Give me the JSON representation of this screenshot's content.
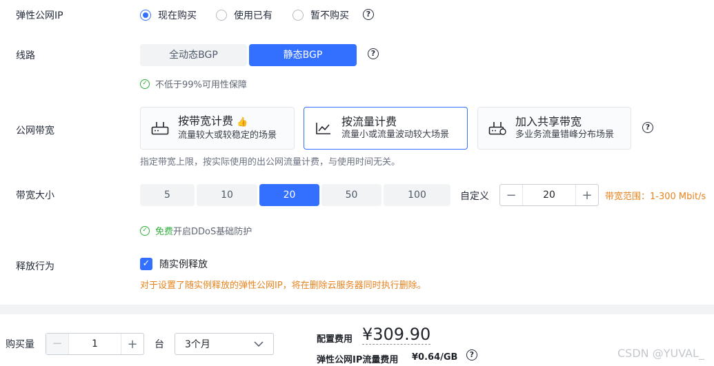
{
  "eip": {
    "label": "弹性公网IP",
    "options": [
      "现在购买",
      "使用已有",
      "暂不购买"
    ]
  },
  "line": {
    "label": "线路",
    "options": [
      "全动态BGP",
      "静态BGP"
    ],
    "note": "不低于99%可用性保障"
  },
  "bandwidth_type": {
    "label": "公网带宽",
    "cards": [
      {
        "title": "按带宽计费",
        "desc": "流量较大或较稳定的场景"
      },
      {
        "title": "按流量计费",
        "desc": "流量小或流量波动较大场景"
      },
      {
        "title": "加入共享带宽",
        "desc": "多业务流量错峰分布场景"
      }
    ],
    "note": "指定带宽上限，按实际使用的出公网流量计费，与使用时间无关。"
  },
  "bandwidth_size": {
    "label": "带宽大小",
    "options": [
      "5",
      "10",
      "20",
      "50",
      "100"
    ],
    "custom_label": "自定义",
    "minus": "−",
    "plus": "+",
    "custom_value": "20",
    "range": "带宽范围：1-300 Mbit/s",
    "ddos_free": "免费",
    "ddos_text": "开启DDoS基础防护"
  },
  "release": {
    "label": "释放行为",
    "checkbox_label": "随实例释放",
    "warning": "对于设置了随实例释放的弹性公网IP，将在删除云服务器同时执行删除。"
  },
  "footer": {
    "qty_label": "购买量",
    "qty_value": "1",
    "minus": "−",
    "plus": "+",
    "unit": "台",
    "duration": "3个月",
    "config_fee_label": "配置费用",
    "config_fee_value": "¥309.90",
    "eip_fee_label": "弹性公网IP流量费用",
    "eip_fee_value": "¥0.64/GB",
    "watermark": "CSDN @YUVAL_"
  },
  "colors": {
    "primary": "#3370ff",
    "success": "#2fae3b",
    "warning": "#e6831e"
  }
}
